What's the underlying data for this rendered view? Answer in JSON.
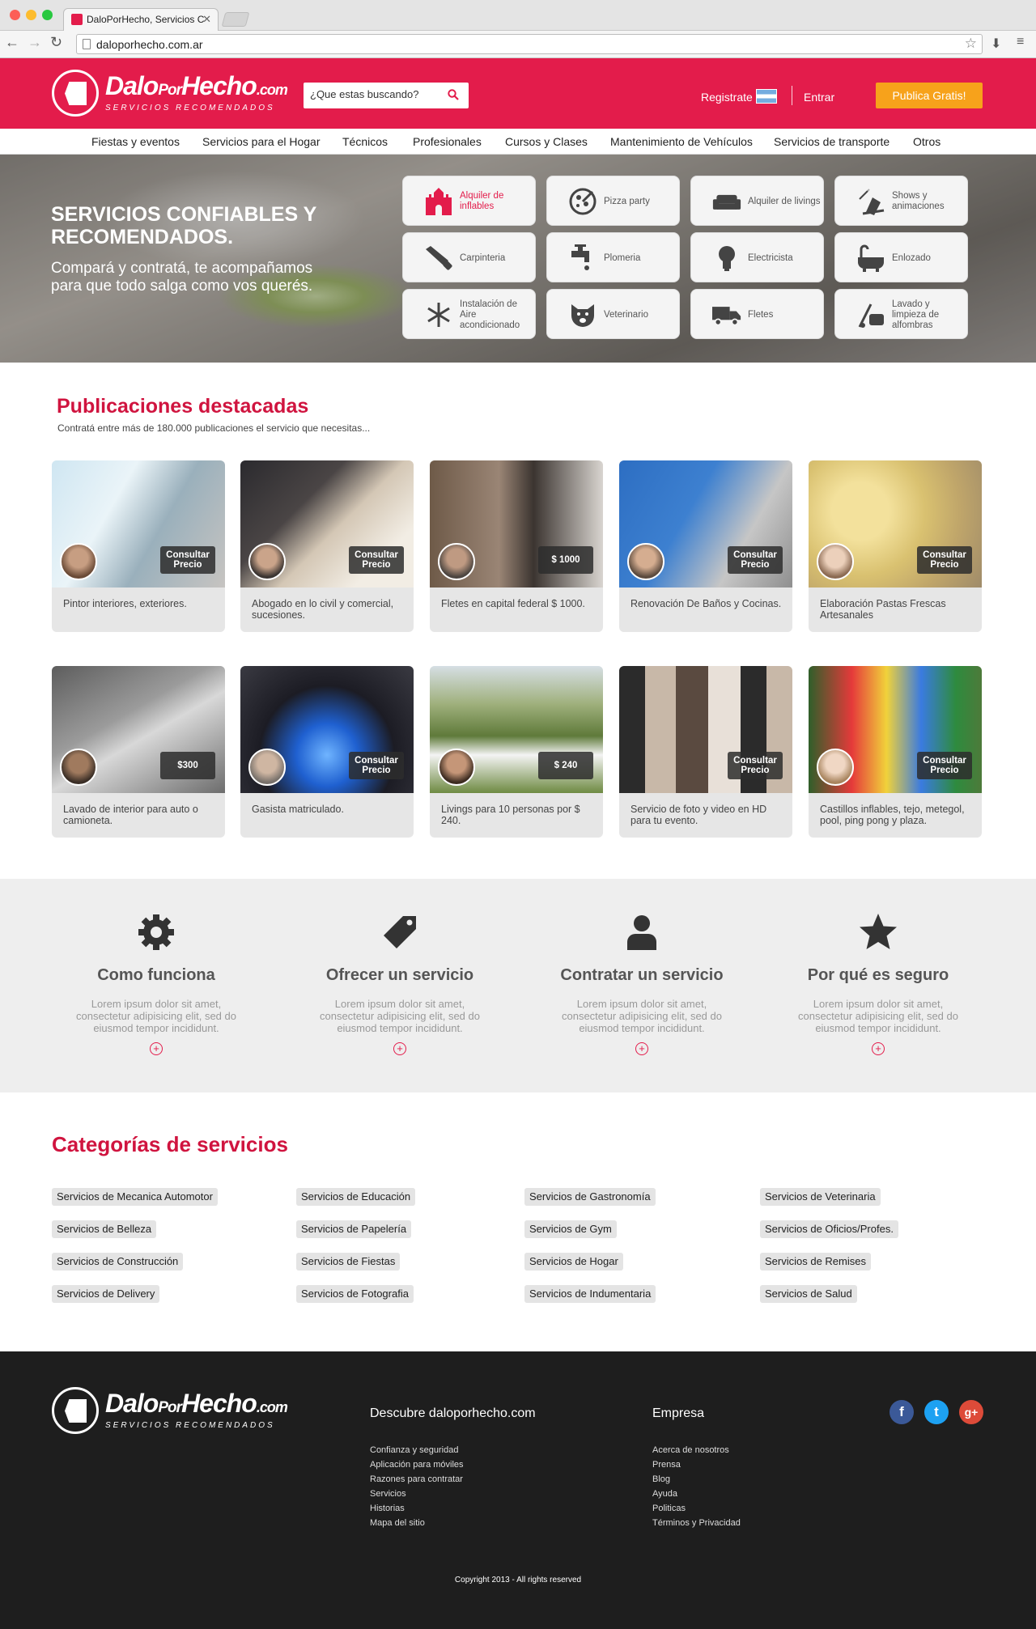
{
  "browser": {
    "tab_title": "DaloPorHecho, Servicios C",
    "url": "daloporhecho.com.ar"
  },
  "header": {
    "logo_dalo": "Dalo",
    "logo_por": "Por",
    "logo_hecho": "Hecho",
    "logo_com": ".com",
    "logo_tagline": "SERVICIOS RECOMENDADOS",
    "search_placeholder": "¿Que estas buscando?",
    "register": "Registrate",
    "login": "Entrar",
    "publish": "Publica Gratis!"
  },
  "nav": {
    "items": [
      "Fiestas y eventos",
      "Servicios para el Hogar",
      "Técnicos",
      "Profesionales",
      "Cursos y Clases",
      "Mantenimiento de Vehículos",
      "Servicios de transporte",
      "Otros"
    ]
  },
  "hero": {
    "title": "SERVICIOS CONFIABLES Y RECOMENDADOS.",
    "subtitle": "Compará y contratá, te acompañamos para que todo salga como vos querés.",
    "tiles": [
      {
        "label": "Alquiler de inflables",
        "icon": "castle-icon"
      },
      {
        "label": "Pizza party",
        "icon": "pizza-icon"
      },
      {
        "label": "Alquiler de livings",
        "icon": "sofa-icon"
      },
      {
        "label": "Shows y animaciones",
        "icon": "magic-hat-icon"
      },
      {
        "label": "Carpinteria",
        "icon": "saw-icon"
      },
      {
        "label": "Plomeria",
        "icon": "faucet-icon"
      },
      {
        "label": "Electricista",
        "icon": "lightbulb-icon"
      },
      {
        "label": "Enlozado",
        "icon": "bathtub-icon"
      },
      {
        "label": "Instalación de Aire acondicionado",
        "icon": "snowflake-icon"
      },
      {
        "label": "Veterinario",
        "icon": "dog-icon"
      },
      {
        "label": "Fletes",
        "icon": "truck-icon"
      },
      {
        "label": "Lavado y limpieza de alfombras",
        "icon": "vacuum-icon"
      }
    ]
  },
  "featured": {
    "title": "Publicaciones destacadas",
    "subtitle": "Contratá entre más de 180.000 publicaciones el servicio que necesitas...",
    "cards": [
      {
        "price": "Consultar Precio",
        "desc": "Pintor interiores, exteriores."
      },
      {
        "price": "Consultar Precio",
        "desc": "Abogado en lo civil y comercial, sucesiones."
      },
      {
        "price": "$ 1000",
        "desc": "Fletes en capital federal $ 1000."
      },
      {
        "price": "Consultar Precio",
        "desc": "Renovación De Baños y Cocinas."
      },
      {
        "price": "Consultar Precio",
        "desc": "Elaboración Pastas Frescas Artesanales"
      },
      {
        "price": "$300",
        "desc": "Lavado de interior para auto o camioneta."
      },
      {
        "price": "Consultar Precio",
        "desc": "Gasista matriculado."
      },
      {
        "price": "$ 240",
        "desc": "Livings para 10 personas por $ 240."
      },
      {
        "price": "Consultar Precio",
        "desc": "Servicio de foto y video en HD para tu evento."
      },
      {
        "price": "Consultar Precio",
        "desc": "Castillos inflables, tejo, metegol, pool, ping pong y plaza."
      }
    ]
  },
  "info": {
    "items": [
      {
        "title": "Como funciona",
        "text": "Lorem ipsum dolor sit amet, consectetur adipisicing elit, sed do eiusmod tempor incididunt.",
        "icon": "gear-icon"
      },
      {
        "title": "Ofrecer un servicio",
        "text": "Lorem ipsum dolor sit amet, consectetur adipisicing elit, sed do eiusmod tempor incididunt.",
        "icon": "tag-icon"
      },
      {
        "title": "Contratar un servicio",
        "text": "Lorem ipsum dolor sit amet, consectetur adipisicing elit, sed do eiusmod tempor incididunt.",
        "icon": "user-icon"
      },
      {
        "title": "Por qué es seguro",
        "text": "Lorem ipsum dolor sit amet, consectetur adipisicing elit, sed do eiusmod tempor incididunt.",
        "icon": "star-icon"
      }
    ],
    "plus": "+"
  },
  "categories": {
    "title": "Categorías de servicios",
    "items": [
      "Servicios de Mecanica Automotor",
      "Servicios de Educación",
      "Servicios de Gastronomía",
      "Servicios de Veterinaria",
      "Servicios de Belleza",
      "Servicios de Papelería",
      "Servicios de Gym",
      "Servicios de Oficios/Profes.",
      "Servicios de Construcción",
      "Servicios de Fiestas",
      "Servicios de Hogar",
      "Servicios de Remises",
      "Servicios de Delivery",
      "Servicios de Fotografia",
      "Servicios de Indumentaria",
      "Servicios de Salud"
    ]
  },
  "footer": {
    "discover_title": "Descubre daloporhecho.com",
    "discover_links": [
      "Confianza y seguridad",
      "Aplicación para móviles",
      "Razones para contratar",
      "Servicios",
      "Historias",
      "Mapa del sitio"
    ],
    "company_title": "Empresa",
    "company_links": [
      "Acerca de nosotros",
      "Prensa",
      "Blog",
      "Ayuda",
      "Politicas",
      "Términos y Privacidad"
    ],
    "social": [
      {
        "name": "facebook-icon",
        "glyph": "f",
        "color": "#3b5998"
      },
      {
        "name": "twitter-icon",
        "glyph": "t",
        "color": "#1da1f2"
      },
      {
        "name": "google-plus-icon",
        "glyph": "g+",
        "color": "#dd4b39"
      }
    ],
    "copyright": "Copyright 2013 - All rights reserved"
  },
  "colors": {
    "brand": "#e31c4b",
    "accent": "#f7a21b",
    "title": "#d0143f"
  }
}
